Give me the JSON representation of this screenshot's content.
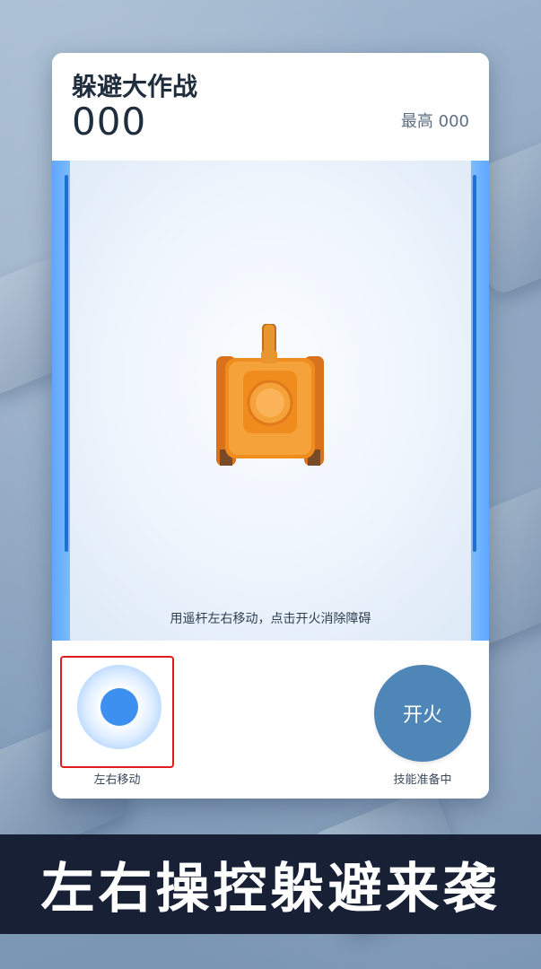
{
  "game": {
    "title": "躲避大作战",
    "score": "000",
    "best_label": "最高 000",
    "hint": "用遥杆左右移动，点击开火消除障碍"
  },
  "controls": {
    "joystick_label": "左右移动",
    "fire_label": "开火",
    "fire_status": "技能准备中"
  },
  "banner": {
    "text": "左右操控躲避来袭"
  },
  "colors": {
    "accent_blue": "#3d8ff0",
    "fire_button": "#4f86b8",
    "rail_blue": "#5ea8ff",
    "banner_bg": "#182035",
    "highlight_red": "#e01c1c"
  },
  "icons": {
    "player": "tank-icon"
  }
}
